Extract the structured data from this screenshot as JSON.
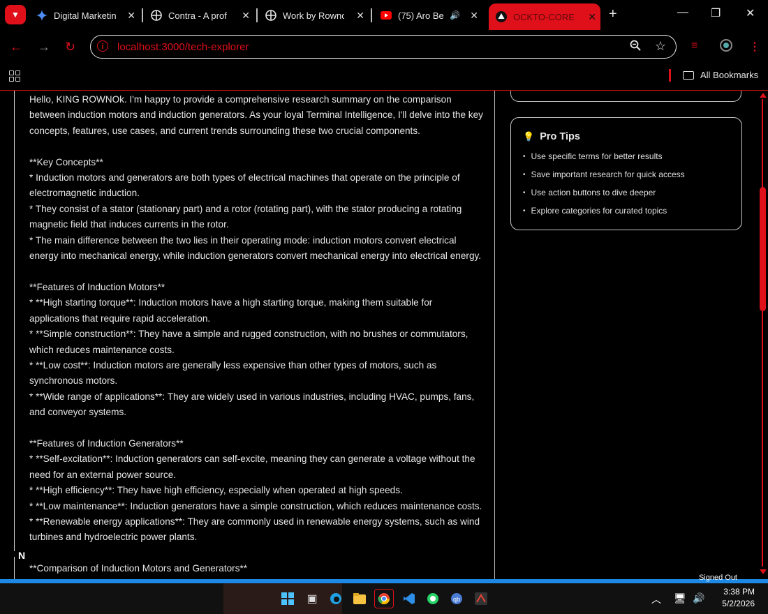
{
  "browser": {
    "tabs": [
      {
        "title": "Digital Marketin",
        "icon": "gemini-icon"
      },
      {
        "title": "Contra - A prof",
        "icon": "contra-icon"
      },
      {
        "title": "Work by Rowno",
        "icon": "contra-icon"
      },
      {
        "title": "(75) Aro Be",
        "icon": "youtube-icon"
      },
      {
        "title": "OCKTO-CORE",
        "icon": "ockto-icon",
        "active": true
      }
    ],
    "url": "localhost:3000/tech-explorer",
    "bookmarks_label": "All Bookmarks"
  },
  "response": {
    "text": "Hello, KING ROWNOk. I'm happy to provide a comprehensive research summary on the comparison between induction motors and induction generators. As your loyal Terminal Intelligence, I'll delve into the key concepts, features, use cases, and current trends surrounding these two crucial components.\n\n**Key Concepts**\n* Induction motors and generators are both types of electrical machines that operate on the principle of electromagnetic induction.\n* They consist of a stator (stationary part) and a rotor (rotating part), with the stator producing a rotating magnetic field that induces currents in the rotor.\n* The main difference between the two lies in their operating mode: induction motors convert electrical energy into mechanical energy, while induction generators convert mechanical energy into electrical energy.\n\n**Features of Induction Motors**\n* **High starting torque**: Induction motors have a high starting torque, making them suitable for applications that require rapid acceleration.\n* **Simple construction**: They have a simple and rugged construction, with no brushes or commutators, which reduces maintenance costs.\n* **Low cost**: Induction motors are generally less expensive than other types of motors, such as synchronous motors.\n* **Wide range of applications**: They are widely used in various industries, including HVAC, pumps, fans, and conveyor systems.\n\n**Features of Induction Generators**\n* **Self-excitation**: Induction generators can self-excite, meaning they can generate a voltage without the need for an external power source.\n* **High efficiency**: They have high efficiency, especially when operated at high speeds.\n* **Low maintenance**: Induction generators have a simple construction, which reduces maintenance costs.\n* **Renewable energy applications**: They are commonly used in renewable energy systems, such as wind turbines and hydroelectric power plants.\n\n**Comparison of Induction Motors and Generators**"
  },
  "pro_tips": {
    "title": "Pro Tips",
    "items": [
      "Use specific terms for better results",
      "Save important research for quick access",
      "Use action buttons to dive deeper",
      "Explore categories for curated topics"
    ]
  },
  "status_bar": {
    "right_text": "Signed Out"
  },
  "taskbar": {
    "time": "3:38 PM",
    "date": "5/2/2026"
  },
  "colors": {
    "accent": "#e0101a",
    "background": "#000000",
    "text": "#e6e6e6"
  }
}
